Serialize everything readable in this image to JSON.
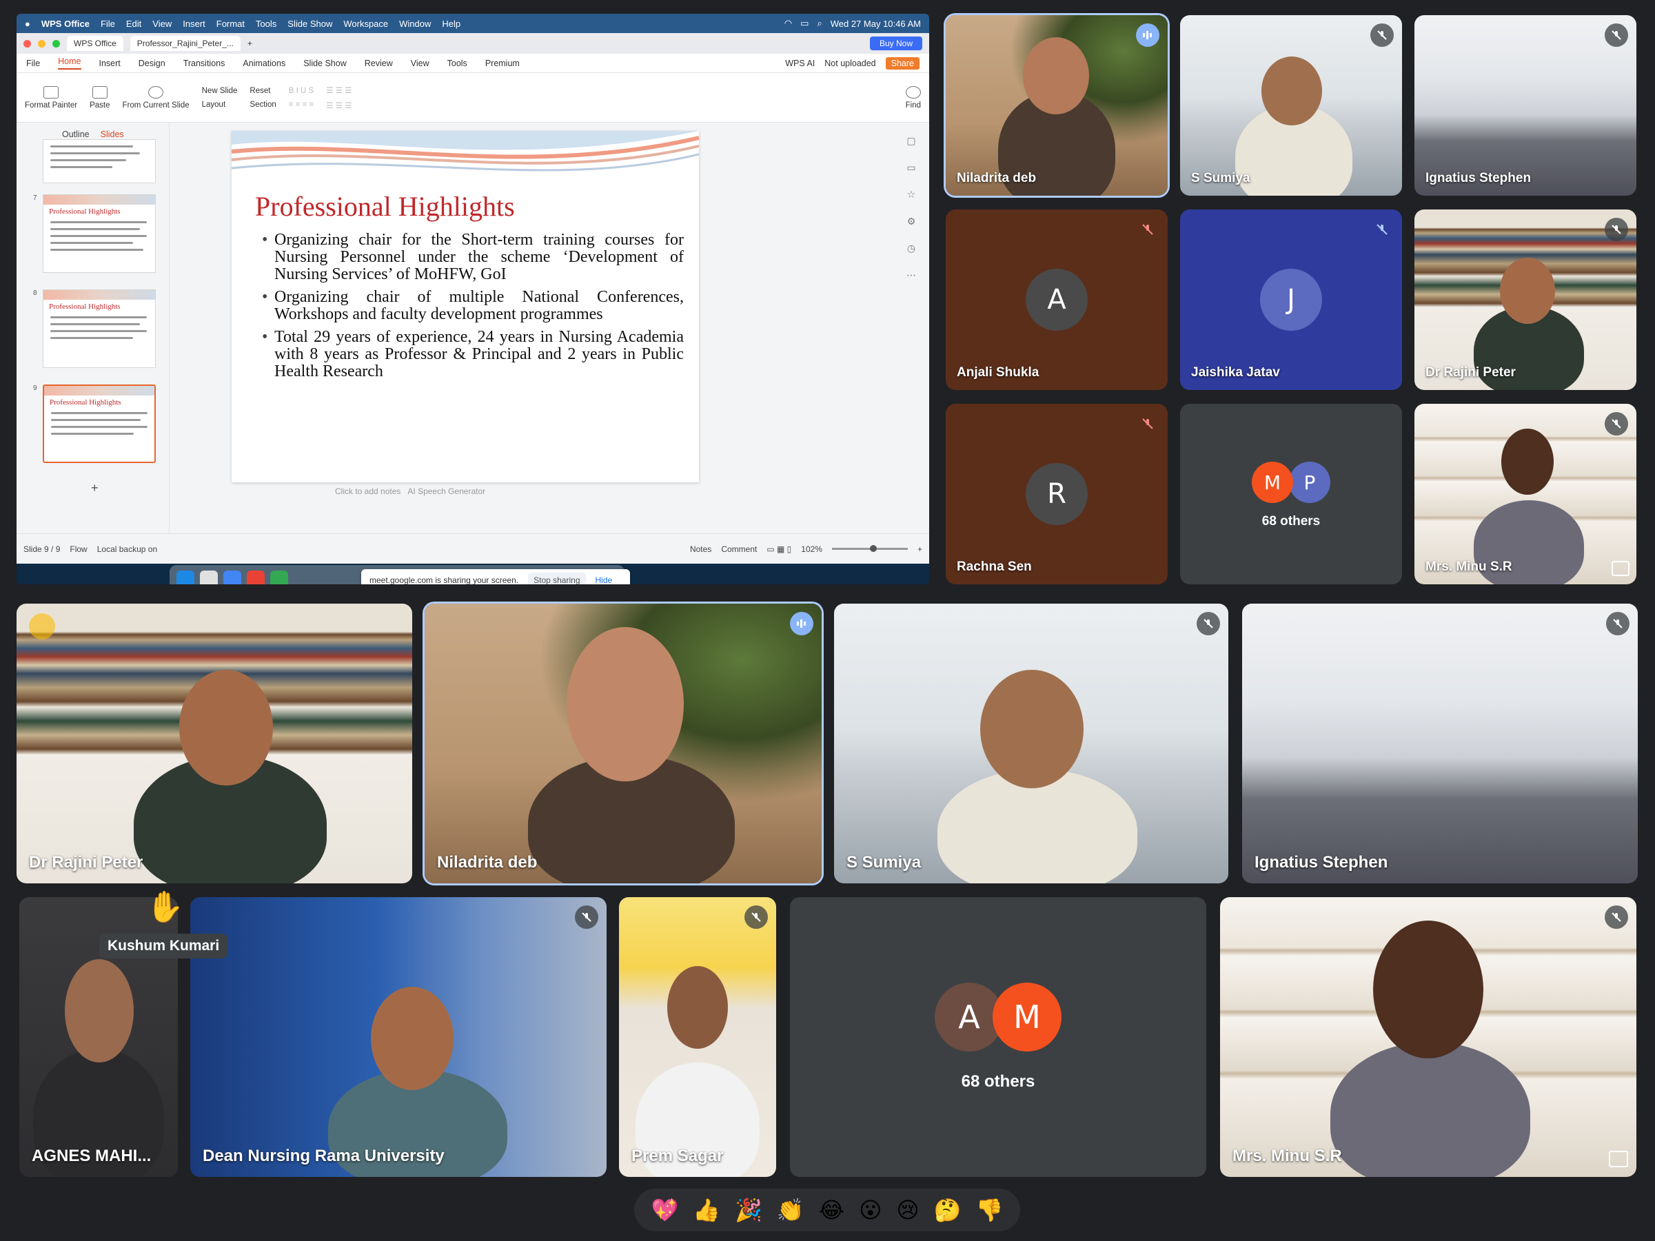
{
  "mac": {
    "app": "WPS Office",
    "menu": [
      "File",
      "Edit",
      "View",
      "Insert",
      "Format",
      "Tools",
      "Slide Show",
      "Workspace",
      "Window",
      "Help"
    ],
    "datetime": "Wed 27 May  10:46 AM"
  },
  "wps": {
    "tab_home": "WPS Office",
    "tab_doc": "Professor_Rajini_Peter_...",
    "buy_now": "Buy Now",
    "file": "File",
    "ribbon_tabs": [
      "Home",
      "Insert",
      "Design",
      "Transitions",
      "Animations",
      "Slide Show",
      "Review",
      "View",
      "Tools",
      "Premium"
    ],
    "wps_ai": "WPS AI",
    "not_uploaded": "Not uploaded",
    "share": "Share",
    "format_painter": "Format Painter",
    "paste": "Paste",
    "from_current_slide": "From Current Slide",
    "new_slide": "New Slide",
    "layout": "Layout",
    "reset": "Reset",
    "section": "Section",
    "find": "Find",
    "outline": "Outline",
    "slides": "Slides",
    "thumb_title": "Professional Highlights",
    "thumb_nums": [
      "7",
      "8",
      "9"
    ],
    "click_notes": "Click to add notes",
    "ai_speech": "AI Speech Generator",
    "status_slide": "Slide 9 / 9",
    "flow": "Flow",
    "backup": "Local backup on",
    "notes": "Notes",
    "comment": "Comment",
    "zoom": "102%"
  },
  "slide": {
    "title": "Professional Highlights",
    "bullets": [
      "Organizing chair for the Short-term training courses for Nursing Personnel under the scheme ‘Development of Nursing Services’ of MoHFW, GoI",
      "Organizing chair of multiple National Conferences, Workshops and faculty development programmes",
      "Total 29 years of experience, 24 years in Nursing Academia with 8 years as Professor & Principal and 2 years in Public Health Research"
    ]
  },
  "screenshare_bar": {
    "message": "meet.google.com is sharing your screen.",
    "stop": "Stop sharing",
    "hide": "Hide"
  },
  "participants_top": [
    {
      "name": "Niladrita deb"
    },
    {
      "name": "S Sumiya"
    },
    {
      "name": "Ignatius Stephen"
    },
    {
      "name": "Anjali Shukla",
      "initial": "A"
    },
    {
      "name": "Jaishika Jatav",
      "initial": "J"
    },
    {
      "name": "Dr Rajini Peter"
    },
    {
      "name": "Rachna Sen",
      "initial": "R"
    },
    {
      "others": "68 others",
      "initials": [
        "M",
        "P"
      ]
    },
    {
      "name": "Mrs. Minu S.R"
    }
  ],
  "participants_mid": [
    {
      "name": "Dr Rajini Peter"
    },
    {
      "name": "Niladrita deb"
    },
    {
      "name": "S Sumiya"
    },
    {
      "name": "Ignatius Stephen"
    }
  ],
  "participants_bottom": [
    {
      "name": "AGNES MAHI..."
    },
    {
      "name": "Dean Nursing Rama University"
    },
    {
      "name": "Prem Sagar"
    },
    {
      "others": "68 others",
      "initials": [
        "A",
        "M"
      ]
    },
    {
      "name": "Mrs. Minu S.R"
    }
  ],
  "hand_tooltip": "Kushum Kumari",
  "reactions": [
    "💖",
    "👍",
    "🎉",
    "👏",
    "😂",
    "😮",
    "😢",
    "🤔",
    "👎"
  ],
  "colors": {
    "accent_orange": "#f4511e",
    "avatar_brown": "#5b2e1a",
    "avatar_blue": "#2f3c9e",
    "highlight": "#aecbfa"
  }
}
